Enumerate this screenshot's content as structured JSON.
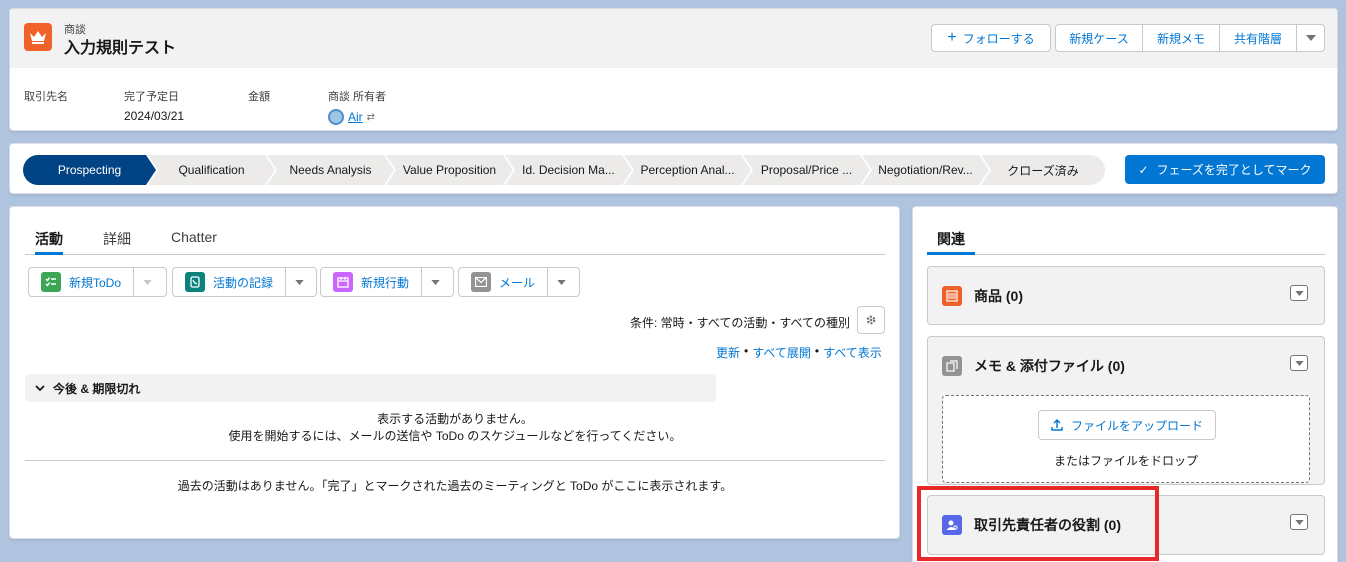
{
  "header": {
    "object_type": "商談",
    "record_title": "入力規則テスト",
    "follow_button": "フォローする",
    "actions": [
      "新規ケース",
      "新規メモ",
      "共有階層"
    ],
    "fields": [
      {
        "label": "取引先名",
        "value": ""
      },
      {
        "label": "完了予定日",
        "value": "2024/03/21"
      },
      {
        "label": "金額",
        "value": ""
      },
      {
        "label": "商談 所有者",
        "value": "Air"
      }
    ]
  },
  "path": {
    "stages": [
      "Prospecting",
      "Qualification",
      "Needs Analysis",
      "Value Proposition",
      "Id. Decision Ma...",
      "Perception Anal...",
      "Proposal/Price ...",
      "Negotiation/Rev...",
      "クローズ済み"
    ],
    "active_index": 0,
    "mark_complete": "フェーズを完了としてマーク"
  },
  "activity": {
    "tabs": [
      "活動",
      "詳細",
      "Chatter"
    ],
    "publishers": [
      "新規ToDo",
      "活動の記録",
      "新規行動",
      "メール"
    ],
    "filter": "条件: 常時・すべての活動・すべての種別",
    "links": [
      "更新",
      "すべて展開",
      "すべて表示"
    ],
    "section_title": "今後 & 期限切れ",
    "empty_line1": "表示する活動がありません。",
    "empty_line2": "使用を開始するには、メールの送信や ToDo のスケジュールなどを行ってください。",
    "past_empty": "過去の活動はありません。「完了」とマークされた過去のミーティングと ToDo がここに表示されます。"
  },
  "related": {
    "tab": "関連",
    "lists": [
      {
        "title": "商品 (0)"
      },
      {
        "title": "メモ & 添付ファイル (0)"
      },
      {
        "title": "取引先責任者の役割 (0)"
      }
    ],
    "upload_button": "ファイルをアップロード",
    "drop_text": "またはファイルをドロップ"
  },
  "colors": {
    "accent": "#0176d3",
    "path_active": "#014486",
    "highlight": "#e8282b"
  }
}
